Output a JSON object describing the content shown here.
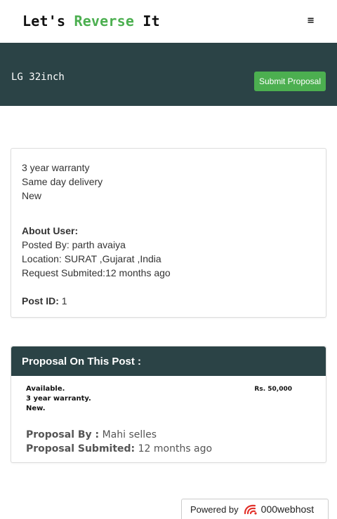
{
  "brand": {
    "part1": "Let's ",
    "part2": "Reverse",
    "part3": " It"
  },
  "nav": {
    "menu_icon": "≡"
  },
  "hero": {
    "title": "LG 32inch",
    "submit_label": "Submit Proposal"
  },
  "post": {
    "details": [
      "3 year warranty",
      "Same day delivery",
      "New"
    ],
    "about_heading": "About User:",
    "posted_by": "Posted By: parth avaiya",
    "location": "Location: SURAT ,Gujarat ,India",
    "request_submitted": "Request Submited:12 months ago",
    "post_id_label": "Post ID:",
    "post_id_value": "1"
  },
  "proposal_section": {
    "title": "Proposal On This Post :",
    "items": [
      {
        "description": [
          "Available.",
          "3 year warranty.",
          "New."
        ],
        "price": "Rs. 50,000",
        "by_label": "Proposal By :",
        "by_value": "Mahi selles",
        "submitted_label": "Proposal Submited:",
        "submitted_value": "12 months ago"
      }
    ]
  },
  "footer": {
    "powered_text": "Powered by",
    "host_name": "000webhost"
  },
  "colors": {
    "accent": "#4caf50",
    "header_dark": "#2b4346"
  }
}
